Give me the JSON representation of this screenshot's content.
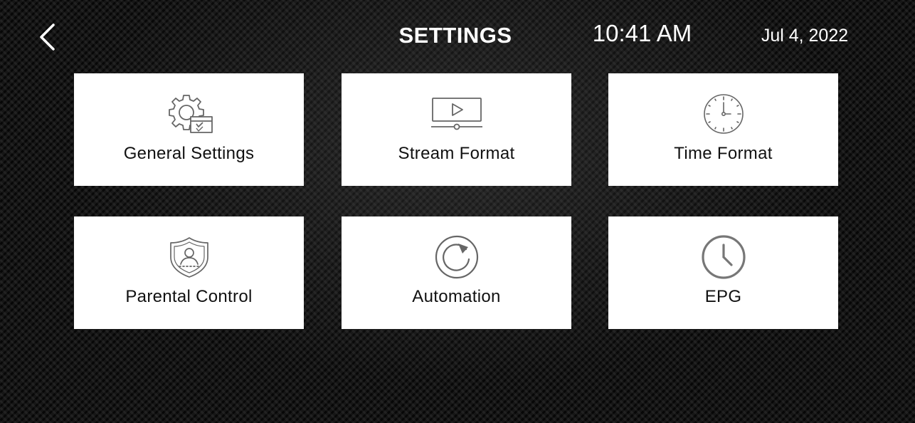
{
  "header": {
    "title": "SETTINGS",
    "time": "10:41 AM",
    "date": "Jul 4, 2022",
    "back_icon": "chevron-left-icon"
  },
  "tiles": [
    {
      "label": "General Settings",
      "icon": "gear-window-icon"
    },
    {
      "label": "Stream Format",
      "icon": "video-player-icon"
    },
    {
      "label": "Time Format",
      "icon": "wall-clock-icon"
    },
    {
      "label": "Parental Control",
      "icon": "shield-user-icon"
    },
    {
      "label": "Automation",
      "icon": "refresh-icon"
    },
    {
      "label": "EPG",
      "icon": "clock-icon"
    }
  ],
  "colors": {
    "tile_background": "#ffffff",
    "tile_text": "#111111",
    "icon_stroke": "#666666",
    "header_text": "#ffffff"
  }
}
